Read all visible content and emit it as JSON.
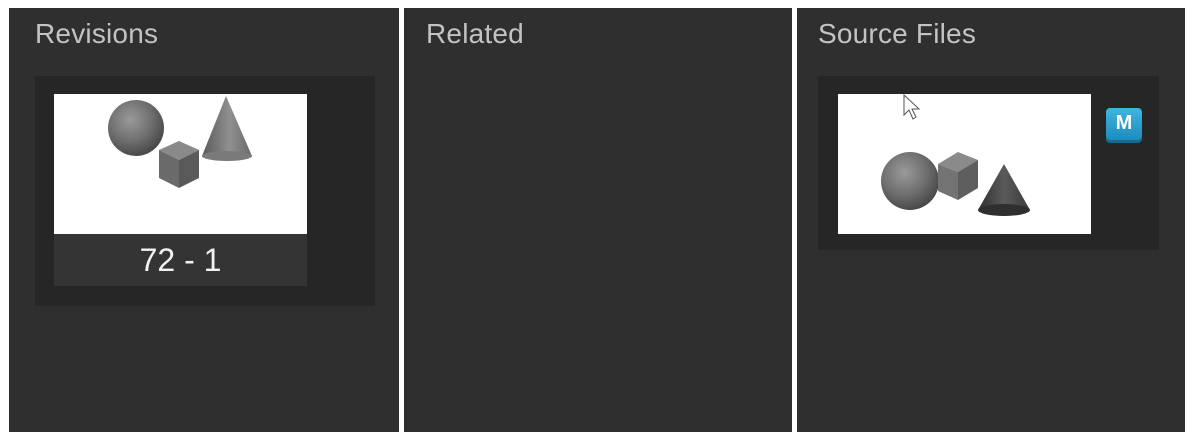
{
  "panels": {
    "revisions": {
      "title": "Revisions",
      "items": [
        {
          "label": "72 - 1"
        }
      ]
    },
    "related": {
      "title": "Related"
    },
    "source_files": {
      "title": "Source Files",
      "items": [
        {
          "app_badge": "M",
          "app_icon": "maya-icon"
        }
      ]
    }
  },
  "colors": {
    "panel_bg": "#2f2f2f",
    "card_bg": "#262626",
    "title_text": "#c3c3c3",
    "badge_accent": "#2aa3d6"
  }
}
